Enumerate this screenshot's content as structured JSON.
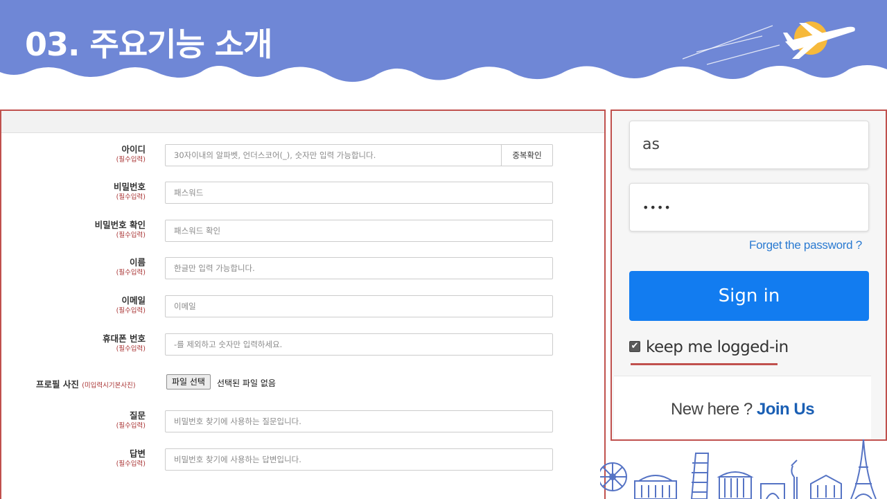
{
  "header": {
    "title": "03. 주요기능 소개"
  },
  "signup_form": {
    "rows": [
      {
        "label": "아이디",
        "required": "(필수입력)",
        "placeholder": "30자이내의 알파벳, 언더스코어(_), 숫자만 입력 가능합니다.",
        "button": "중복확인"
      },
      {
        "label": "비밀번호",
        "required": "(필수입력)",
        "placeholder": "패스워드"
      },
      {
        "label": "비밀번호 확인",
        "required": "(필수입력)",
        "placeholder": "패스워드 확인"
      },
      {
        "label": "이름",
        "required": "(필수입력)",
        "placeholder": "한글만 입력 가능합니다."
      },
      {
        "label": "이메일",
        "required": "(필수입력)",
        "placeholder": "이메일"
      },
      {
        "label": "휴대폰 번호",
        "required": "(필수입력)",
        "placeholder": "-를 제외하고 숫자만 입력하세요."
      },
      {
        "label": "질문",
        "required": "(필수입력)",
        "placeholder": "비밀번호 찾기에 사용하는 질문입니다."
      },
      {
        "label": "답변",
        "required": "(필수입력)",
        "placeholder": "비밀번호 찾기에 사용하는 답변입니다."
      }
    ],
    "photo": {
      "label": "프로필 사진",
      "optional": "(미입력시기본사진)",
      "file_button": "파일 선택",
      "file_status": "선택된 파일 없음"
    }
  },
  "login": {
    "username_value": "as",
    "password_value": "••••",
    "forgot_link": "Forget the password ?",
    "signin_button": "Sign in",
    "remember_checked": true,
    "remember_label": "keep me logged-in",
    "new_here": "New here ?",
    "join_link": "Join Us"
  },
  "colors": {
    "banner": "#6f87d6",
    "panel_border": "#c0504d",
    "signin_blue": "#127cf0",
    "link_blue": "#2a7ad1",
    "required_red": "#a83232"
  },
  "decorations": {
    "banner_icon": "airplane-sun-icon",
    "landmarks_icon": "world-landmarks-icon"
  }
}
